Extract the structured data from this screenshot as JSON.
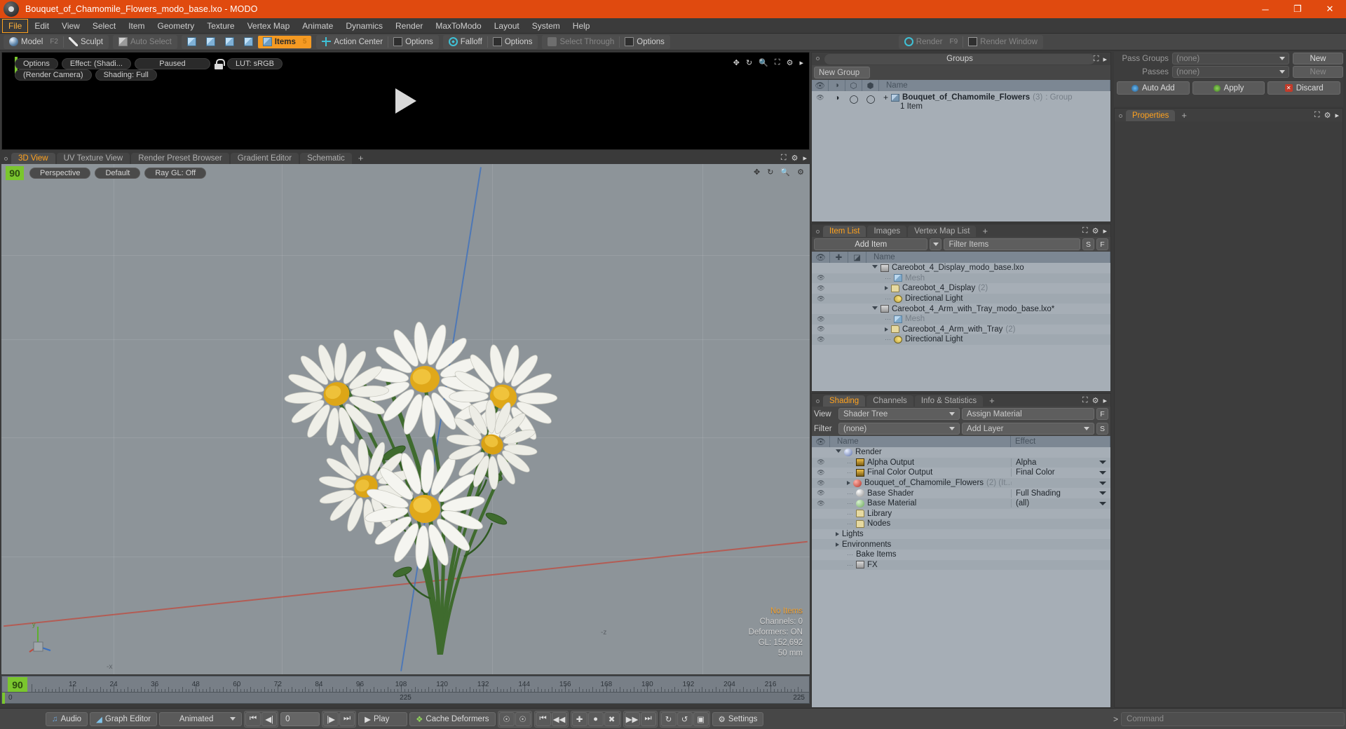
{
  "window": {
    "title": "Bouquet_of_Chamomile_Flowers_modo_base.lxo - MODO",
    "minimize": "─",
    "maximize": "❐",
    "close": "✕"
  },
  "menubar": [
    "File",
    "Edit",
    "View",
    "Select",
    "Item",
    "Geometry",
    "Texture",
    "Vertex Map",
    "Animate",
    "Dynamics",
    "Render",
    "MaxToModo",
    "Layout",
    "System",
    "Help"
  ],
  "toolbar": {
    "model": "Model",
    "model_key": "F2",
    "sculpt": "Sculpt",
    "auto_select": "Auto Select",
    "items": "Items",
    "items_num": "5",
    "action_center": "Action Center",
    "options1": "Options",
    "falloff": "Falloff",
    "options2": "Options",
    "select_through": "Select Through",
    "options3": "Options",
    "render": "Render",
    "render_key": "F9",
    "render_window": "Render Window"
  },
  "preview": {
    "options": "Options",
    "effect": "Effect: (Shadi...",
    "paused": "Paused",
    "lut": "LUT: sRGB",
    "render_camera": "(Render Camera)",
    "shading": "Shading: Full"
  },
  "viewport_tabs": {
    "tabs": [
      "3D View",
      "UV Texture View",
      "Render Preset Browser",
      "Gradient Editor",
      "Schematic"
    ],
    "active": "3D View",
    "plus": "+"
  },
  "viewport": {
    "frame_badge": "90",
    "perspective": "Perspective",
    "default": "Default",
    "raygl": "Ray GL: Off",
    "info": {
      "no_items": "No Items",
      "channels": "Channels: 0",
      "deformers": "Deformers: ON",
      "gl": "GL: 152,692",
      "lens": "50 mm"
    },
    "axis_labels": {
      "minus_x": "-x",
      "minus_z": "-z",
      "y": "y"
    }
  },
  "groups_panel": {
    "title": "Groups",
    "new_group": "New Group",
    "columns": [
      "Name"
    ],
    "rows": [
      {
        "name": "Bouquet_of_Chamomile_Flowers",
        "count": "(3)",
        "type": ": Group",
        "sub": "1 Item"
      }
    ]
  },
  "item_list": {
    "tabs": [
      "Item List",
      "Images",
      "Vertex Map List"
    ],
    "active": "Item List",
    "plus": "+",
    "add_item": "Add Item",
    "filter_placeholder": "Filter Items",
    "btn_s": "S",
    "btn_f": "F",
    "column_name": "Name",
    "rows": [
      {
        "label": "Careobot_4_Display_modo_base.lxo",
        "icon": "clapper-icon",
        "indent": 0,
        "expander": "down",
        "muted": false,
        "eye": false
      },
      {
        "label": "Mesh",
        "icon": "mesh-icon",
        "indent": 1,
        "expander": "none",
        "muted": true,
        "eye": true
      },
      {
        "label": "Careobot_4_Display",
        "count": "(2)",
        "icon": "folder-icon",
        "indent": 1,
        "expander": "right",
        "muted": false,
        "eye": true
      },
      {
        "label": "Directional Light",
        "icon": "light-icon",
        "indent": 1,
        "expander": "none",
        "muted": false,
        "eye": true
      },
      {
        "label": "Careobot_4_Arm_with_Tray_modo_base.lxo*",
        "icon": "clapper-icon",
        "indent": 0,
        "expander": "down",
        "muted": false,
        "eye": false
      },
      {
        "label": "Mesh",
        "icon": "mesh-icon",
        "indent": 1,
        "expander": "none",
        "muted": true,
        "eye": true
      },
      {
        "label": "Careobot_4_Arm_with_Tray",
        "count": "(2)",
        "icon": "folder-icon",
        "indent": 1,
        "expander": "right",
        "muted": false,
        "eye": true
      },
      {
        "label": "Directional Light",
        "icon": "light-icon",
        "indent": 1,
        "expander": "none",
        "muted": false,
        "eye": true
      }
    ]
  },
  "shading_panel": {
    "tabs": [
      "Shading",
      "Channels",
      "Info & Statistics"
    ],
    "active": "Shading",
    "plus": "+",
    "view_label": "View",
    "view_value": "Shader Tree",
    "assign_material": "Assign Material",
    "btn_f": "F",
    "filter_label": "Filter",
    "filter_value": "(none)",
    "add_layer": "Add Layer",
    "btn_s": "S",
    "col_name": "Name",
    "col_effect": "Effect",
    "rows": [
      {
        "label": "Render",
        "effect": "",
        "icon": "blue-ball-icon",
        "indent": 0,
        "expander": "down",
        "eye": false,
        "dropdown": false
      },
      {
        "label": "Alpha Output",
        "effect": "Alpha",
        "icon": "image-icon",
        "indent": 1,
        "expander": "none",
        "eye": true,
        "dropdown": true
      },
      {
        "label": "Final Color Output",
        "effect": "Final Color",
        "icon": "image-icon",
        "indent": 1,
        "expander": "none",
        "eye": true,
        "dropdown": true
      },
      {
        "label": "Bouquet_of_Chamomile_Flowers",
        "count": "(2) (It...",
        "effect": "",
        "icon": "red-ball-icon",
        "indent": 1,
        "expander": "right",
        "eye": true,
        "dropdown": true
      },
      {
        "label": "Base Shader",
        "effect": "Full Shading",
        "icon": "white-ball-icon",
        "indent": 1,
        "expander": "none",
        "eye": true,
        "dropdown": true
      },
      {
        "label": "Base Material",
        "effect": "(all)",
        "icon": "green-ball-icon",
        "indent": 1,
        "expander": "none",
        "eye": true,
        "dropdown": true
      },
      {
        "label": "Library",
        "effect": "",
        "icon": "folder-icon",
        "indent": 1,
        "expander": "none",
        "eye": false,
        "dropdown": false
      },
      {
        "label": "Nodes",
        "effect": "",
        "icon": "folder-icon",
        "indent": 1,
        "expander": "none",
        "eye": false,
        "dropdown": false
      },
      {
        "label": "Lights",
        "effect": "",
        "icon": "none",
        "indent": 0,
        "expander": "right",
        "eye": false,
        "dropdown": false
      },
      {
        "label": "Environments",
        "effect": "",
        "icon": "none",
        "indent": 0,
        "expander": "right",
        "eye": false,
        "dropdown": false
      },
      {
        "label": "Bake Items",
        "effect": "",
        "icon": "none",
        "indent": 1,
        "expander": "none",
        "eye": false,
        "dropdown": false
      },
      {
        "label": "FX",
        "effect": "",
        "icon": "clapper-icon",
        "indent": 1,
        "expander": "none",
        "eye": false,
        "dropdown": false
      }
    ]
  },
  "passes_panel": {
    "pass_groups_label": "Pass Groups",
    "pass_groups_value": "(none)",
    "new_button": "New",
    "passes_label": "Passes",
    "passes_value": "(none)",
    "new_button2": "New",
    "auto_add": "Auto Add",
    "apply": "Apply",
    "discard": "Discard"
  },
  "properties_panel": {
    "title": "Properties",
    "plus": "+"
  },
  "timeline": {
    "current_frame_badge": "90",
    "ticks": [
      0,
      12,
      24,
      36,
      48,
      60,
      72,
      84,
      96,
      108,
      120,
      132,
      144,
      156,
      168,
      180,
      192,
      204,
      216
    ],
    "range_start": "0",
    "range_mid": "225",
    "range_end": "225"
  },
  "statusbar": {
    "audio": "Audio",
    "graph_editor": "Graph Editor",
    "animated": "Animated",
    "frame_value": "0",
    "play": "Play",
    "cache_deformers": "Cache Deformers",
    "settings": "Settings",
    "command_prompt": ">",
    "command_placeholder": "Command"
  },
  "colors": {
    "accent": "#ffa21e",
    "title_bar": "#e04a0f",
    "panel_bg": "#464646",
    "tree_bg": "#a6aeb6",
    "green": "#7ac62e"
  }
}
